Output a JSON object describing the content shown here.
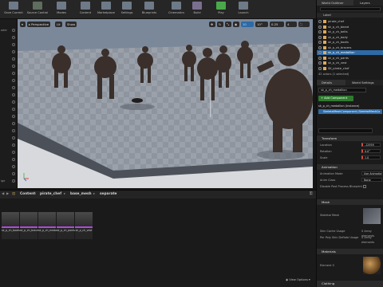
{
  "toolbar": {
    "buttons": [
      {
        "label": "Save Current",
        "icon": "save-icon"
      },
      {
        "label": "Source Control",
        "icon": "source-control-icon"
      },
      {
        "label": "Modes",
        "icon": "modes-icon"
      },
      {
        "label": "Content",
        "icon": "content-icon"
      },
      {
        "label": "Marketplace",
        "icon": "marketplace-icon"
      },
      {
        "label": "Settings",
        "icon": "settings-icon"
      },
      {
        "label": "Blueprints",
        "icon": "blueprints-icon"
      },
      {
        "label": "Cinematics",
        "icon": "cinematics-icon"
      },
      {
        "label": "Build",
        "icon": "build-icon"
      },
      {
        "label": "Play",
        "icon": "play-icon"
      },
      {
        "label": "Launch",
        "icon": "launch-icon"
      }
    ]
  },
  "left_strip": {
    "labels": [
      "ader",
      "",
      "",
      "",
      "",
      "",
      "",
      "",
      "",
      "",
      "",
      "",
      "",
      "",
      "",
      "",
      "",
      "",
      "",
      "",
      "",
      "ige"
    ]
  },
  "viewport": {
    "perspective_label": "Perspective",
    "lit_label": "Lit",
    "show_label": "Show",
    "grid_value": "10",
    "angle_value": "10°",
    "scale_value": "0.25",
    "camera_speed": "4"
  },
  "world_outliner": {
    "tab_label": "World Outliner",
    "layers_tab": "Layers",
    "column_label": "Label",
    "rows": [
      {
        "name": "pirate_chef",
        "selected": false
      },
      {
        "name": "sk_p_ch_beard",
        "selected": false
      },
      {
        "name": "sk_p_ch_belts",
        "selected": false
      },
      {
        "name": "sk_p_ch_body",
        "selected": false
      },
      {
        "name": "sk_p_ch_boots",
        "selected": false
      },
      {
        "name": "sk_p_ch_bracers",
        "selected": false
      },
      {
        "name": "sk_p_ch_medallion",
        "selected": true
      },
      {
        "name": "sk_p_ch_pants",
        "selected": false
      },
      {
        "name": "sk_p_ch_vest",
        "selected": false
      },
      {
        "name": "SK_pirate_chef",
        "selected": false
      }
    ],
    "footer": "42 actors (1 selected)"
  },
  "details": {
    "tab_label": "Details",
    "world_settings_tab": "World Settings",
    "name_value": "sk_p_ch_medallion",
    "add_component": "+ Add Component",
    "component_root": "sk_p_ch_medallion (Instance)",
    "component_child": "SkeletalMeshComponent (SkeletalMeshCo",
    "search_placeholder": "Search Details",
    "transform_header": "Transform",
    "location_label": "Location",
    "location_value": "-12959",
    "rotation_label": "Rotation",
    "rotation_value": "0.0°",
    "scale_label": "Scale",
    "scale_value": "1.0",
    "animation_header": "Animation",
    "anim_mode_label": "Animation Mode",
    "anim_mode_value": "Use Animation Bl",
    "anim_class_label": "Anim Class",
    "anim_class_value": "None",
    "disable_post_label": "Disable Post Process Blueprint",
    "mesh_header": "Mesh",
    "skeletal_mesh_label": "Skeletal Mesh",
    "skin_cache_label": "Skin Cache Usage",
    "skin_cache_value": "0 Array elements",
    "per_poly_label": "Per Poly Skin Deflate Usage",
    "per_poly_value": "0 Array elements",
    "materials_header": "Materials",
    "element0_label": "Element 0",
    "clothing_header": "Clothing"
  },
  "content_browser": {
    "breadcrumbs": [
      "Content",
      "pirate_chef",
      "base_mesh",
      "separate"
    ],
    "assets": [
      {
        "name": "sk_p_ch_boots"
      },
      {
        "name": "sk_p_ch_bracers"
      },
      {
        "name": "sk_p_ch_medallion"
      },
      {
        "name": "sk_p_ch_pants"
      },
      {
        "name": "sk_p_ch_vest"
      }
    ],
    "view_options": "View Options"
  },
  "colors": {
    "accent_orange": "#e2852b",
    "selection_blue": "#2d6aa6",
    "asset_stripe": "#b04ad8"
  }
}
